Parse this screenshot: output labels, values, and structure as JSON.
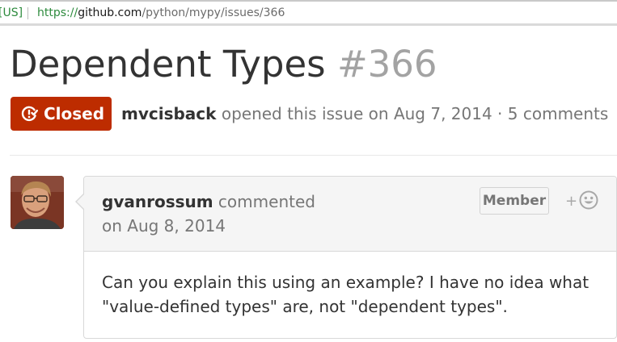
{
  "browser": {
    "identity_label": "[US]",
    "url_scheme": "https://",
    "url_host": "github.com",
    "url_path": "/python/mypy/issues/366"
  },
  "issue": {
    "title": "Dependent Types",
    "number": "#366",
    "state": "Closed",
    "state_icon": "issue-closed-icon",
    "author": "mvcisback",
    "opened_text": " opened this issue on Aug 7, 2014 · 5 comments"
  },
  "comment": {
    "avatar_icon": "user-avatar",
    "author": "gvanrossum",
    "action": " commented",
    "date": "on Aug 8, 2014",
    "role_badge": "Member",
    "reaction_plus": "+",
    "reaction_icon": "smiley-icon",
    "body_line_1": "Can you explain this using an example? I have no idea what",
    "body_line_2": "\"value-defined types\" are, not \"dependent types\"."
  },
  "colors": {
    "closed_badge": "#bd2c00",
    "url_secure": "#2e8b3e",
    "title": "#333333",
    "issue_number": "#a3a3a3"
  }
}
